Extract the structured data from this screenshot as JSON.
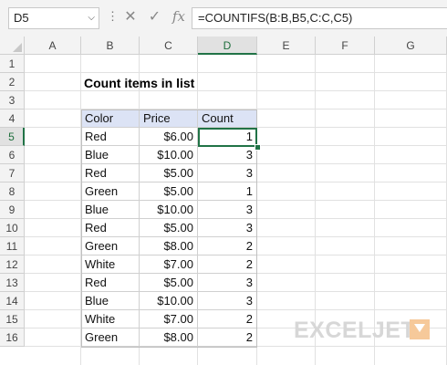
{
  "formula_bar": {
    "name_box": "D5",
    "cancel_icon": "✕",
    "enter_icon": "✓",
    "fx_label": "fx",
    "formula": "=COUNTIFS(B:B,B5,C:C,C5)"
  },
  "columns": [
    "A",
    "B",
    "C",
    "D",
    "E",
    "F",
    "G"
  ],
  "rows": [
    "1",
    "2",
    "3",
    "4",
    "5",
    "6",
    "7",
    "8",
    "9",
    "10",
    "11",
    "12",
    "13",
    "14",
    "15",
    "16"
  ],
  "selected": {
    "column": "D",
    "row": "5"
  },
  "sheet": {
    "title": "Count items in list",
    "headers": {
      "color": "Color",
      "price": "Price",
      "count": "Count"
    },
    "data": [
      {
        "color": "Red",
        "price": "$6.00",
        "count": "1"
      },
      {
        "color": "Blue",
        "price": "$10.00",
        "count": "3"
      },
      {
        "color": "Red",
        "price": "$5.00",
        "count": "3"
      },
      {
        "color": "Green",
        "price": "$5.00",
        "count": "1"
      },
      {
        "color": "Blue",
        "price": "$10.00",
        "count": "3"
      },
      {
        "color": "Red",
        "price": "$5.00",
        "count": "3"
      },
      {
        "color": "Green",
        "price": "$8.00",
        "count": "2"
      },
      {
        "color": "White",
        "price": "$7.00",
        "count": "2"
      },
      {
        "color": "Red",
        "price": "$5.00",
        "count": "3"
      },
      {
        "color": "Blue",
        "price": "$10.00",
        "count": "3"
      },
      {
        "color": "White",
        "price": "$7.00",
        "count": "2"
      },
      {
        "color": "Green",
        "price": "$8.00",
        "count": "2"
      }
    ]
  },
  "watermark": {
    "text": "EXCELJET",
    "accent_color": "#f6c99a"
  },
  "colors": {
    "header_fill": "#dce3f5",
    "selection": "#217346"
  }
}
